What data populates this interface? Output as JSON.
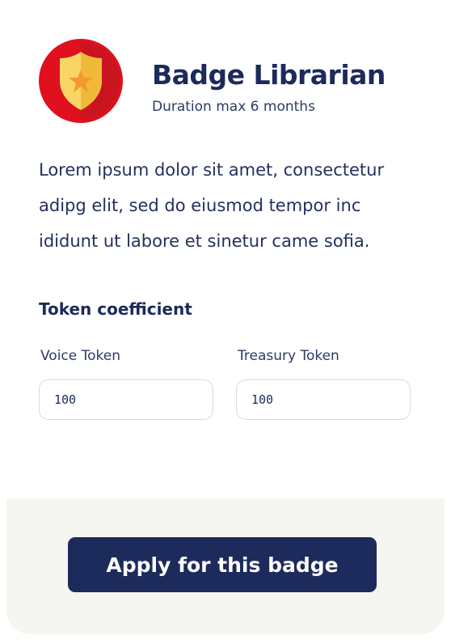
{
  "badge": {
    "icon": "shield-star-badge-icon",
    "title": "Badge Librarian",
    "duration": "Duration max 6 months",
    "description": "Lorem ipsum dolor sit amet, consectetur adipg elit, sed do eiusmod tempor inc ididunt ut labore et sinetur came sofia."
  },
  "token_section": {
    "title": "Token coefficient",
    "voice": {
      "label": "Voice Token",
      "value": "100"
    },
    "treasury": {
      "label": "Treasury Token",
      "value": "100"
    }
  },
  "footer": {
    "apply_label": "Apply for this badge"
  },
  "colors": {
    "primary": "#1c2a5c",
    "footer_bg": "#f5f5f1",
    "badge_red": "#d8212b",
    "badge_gold": "#f7c948"
  }
}
